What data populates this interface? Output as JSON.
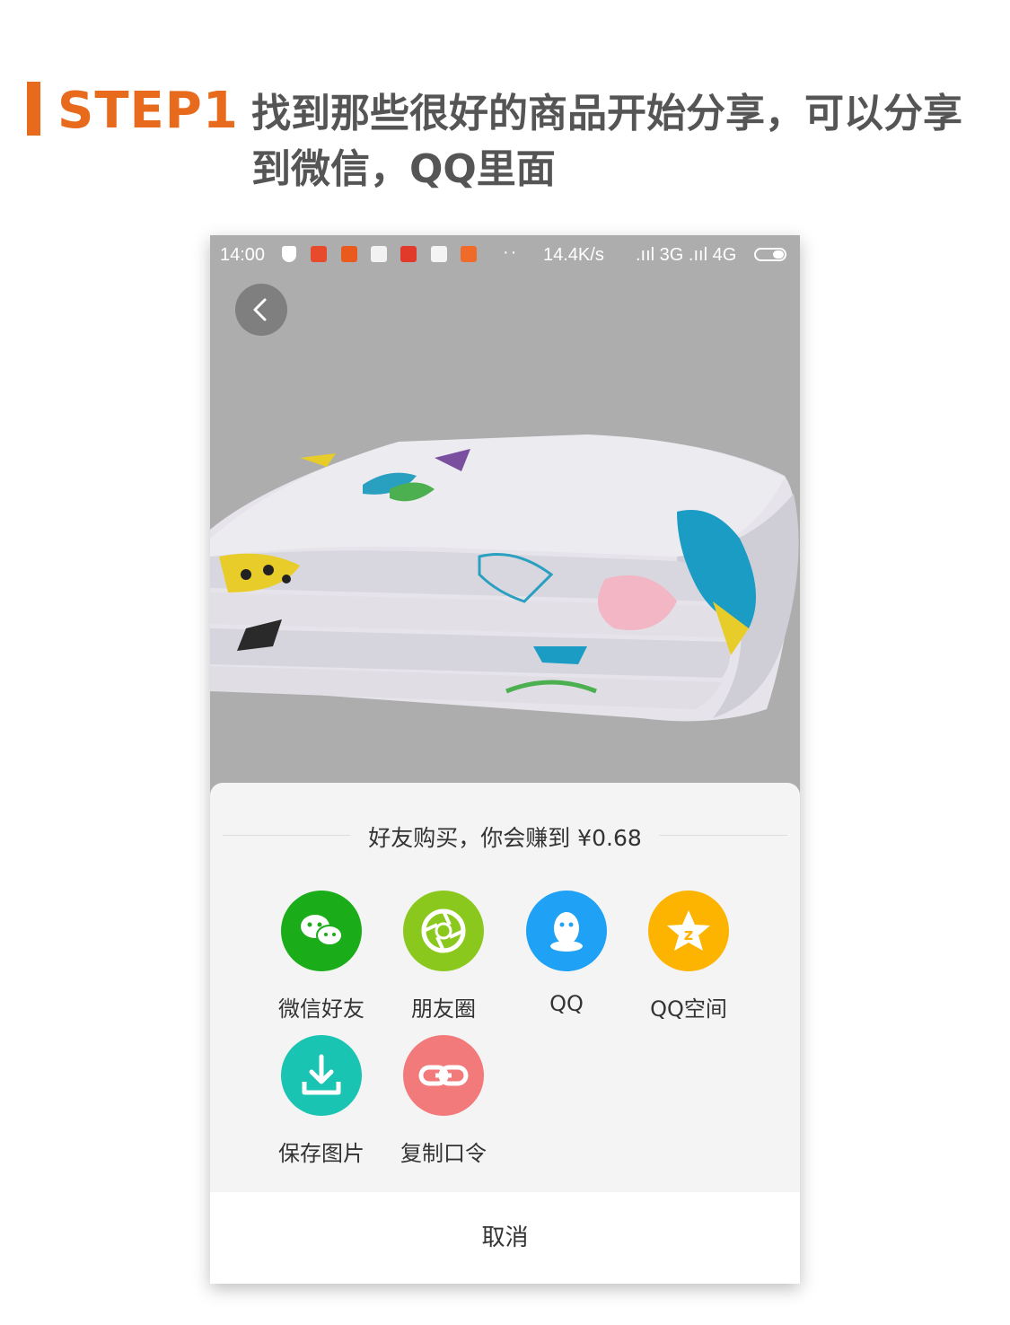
{
  "header": {
    "step_label": "STEP1",
    "title": "找到那些很好的商品开始分享，可以分享到微信，QQ里面",
    "accent_color": "#e86a1d"
  },
  "statusbar": {
    "time": "14:00",
    "dots": "··",
    "speed": "14.4K/s",
    "signal": ".ııl 3G .ııl 4G"
  },
  "product": {
    "image": "folded-quilt-pineapple-pattern"
  },
  "share_sheet": {
    "earn_text": "好友购买，你会赚到 ¥0.68",
    "items": [
      {
        "label": "微信好友",
        "icon": "wechat-icon",
        "color": "#1aad19"
      },
      {
        "label": "朋友圈",
        "icon": "moments-icon",
        "color": "#8bc81e"
      },
      {
        "label": "QQ",
        "icon": "qq-icon",
        "color": "#1fa1f5"
      },
      {
        "label": "QQ空间",
        "icon": "qzone-icon",
        "color": "#fdb400"
      },
      {
        "label": "保存图片",
        "icon": "download-icon",
        "color": "#19c4b2"
      },
      {
        "label": "复制口令",
        "icon": "link-icon",
        "color": "#f37a7a"
      }
    ],
    "cancel_label": "取消"
  }
}
